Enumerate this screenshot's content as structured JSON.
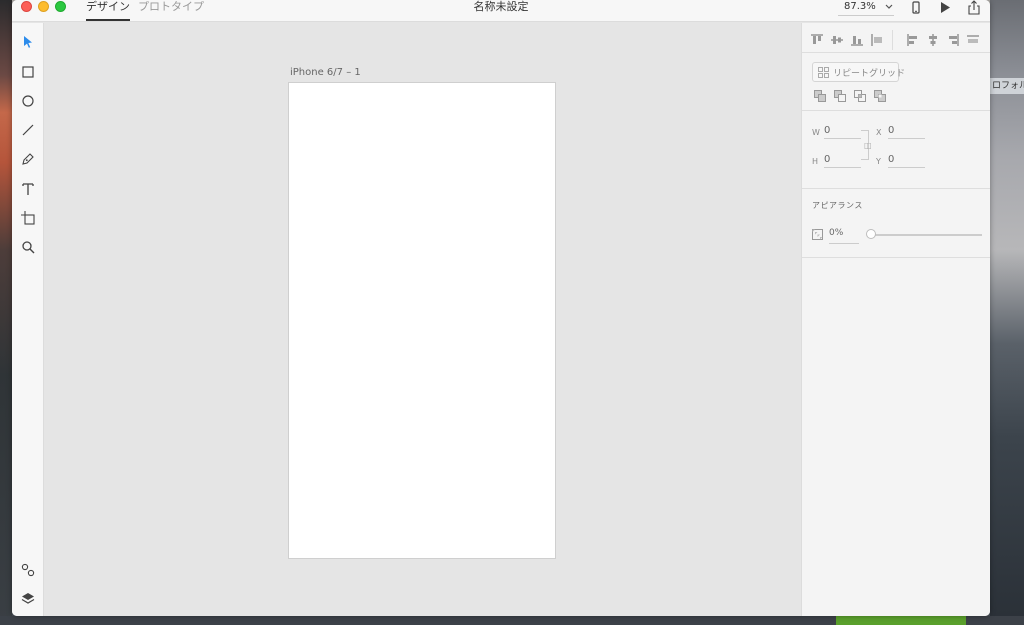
{
  "window": {
    "tabs": [
      {
        "label": "デザイン",
        "active": true
      },
      {
        "label": "プロトタイプ",
        "active": false
      }
    ],
    "title": "名称未設定",
    "zoom": "87.3%"
  },
  "desktop": {
    "right_label": "ロフォル"
  },
  "toolbar": {
    "tools": [
      "select-icon",
      "rectangle-icon",
      "ellipse-icon",
      "line-icon",
      "pen-icon",
      "text-icon",
      "artboard-icon",
      "zoom-icon"
    ],
    "bottom_tools": [
      "symbols-icon",
      "layers-icon"
    ]
  },
  "canvas": {
    "artboard_label": "iPhone 6/7 – 1"
  },
  "inspector": {
    "repeat_grid_label": "リピートグリッド",
    "fields": {
      "w_label": "W",
      "w_value": "0",
      "x_label": "X",
      "x_value": "0",
      "h_label": "H",
      "h_value": "0",
      "y_label": "Y",
      "y_value": "0"
    },
    "appearance_title": "アピアランス",
    "opacity_value": "0%",
    "opacity_level": 0
  },
  "colors": {
    "accent": "#2d8ceb",
    "close": "#fc5f57",
    "minimize": "#fdbc2e",
    "maximize": "#2bc840"
  }
}
